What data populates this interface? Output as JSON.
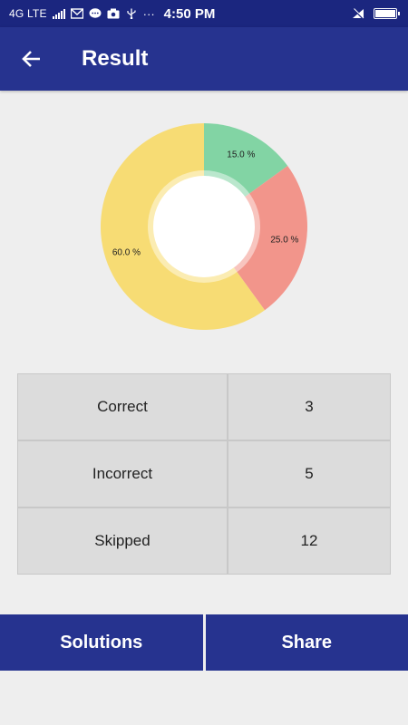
{
  "status_bar": {
    "network": "4G LTE",
    "time": "4:50 PM",
    "more": "···"
  },
  "app_bar": {
    "title": "Result",
    "back_icon": "arrow-left-icon"
  },
  "chart_data": {
    "type": "pie",
    "style": "donut",
    "slices": [
      {
        "label": "15.0 %",
        "value": 15.0,
        "color": "#82d4a4"
      },
      {
        "label": "25.0 %",
        "value": 25.0,
        "color": "#f2958b"
      },
      {
        "label": "60.0 %",
        "value": 60.0,
        "color": "#f7dc74"
      }
    ]
  },
  "results": {
    "rows": [
      {
        "label": "Correct",
        "value": "3"
      },
      {
        "label": "Incorrect",
        "value": "5"
      },
      {
        "label": "Skipped",
        "value": "12"
      }
    ]
  },
  "actions": {
    "solutions_label": "Solutions",
    "share_label": "Share"
  },
  "colors": {
    "primary": "#26338f",
    "status_bar": "#1b267f",
    "background": "#eeeeee",
    "cell": "#dcdcdc"
  }
}
